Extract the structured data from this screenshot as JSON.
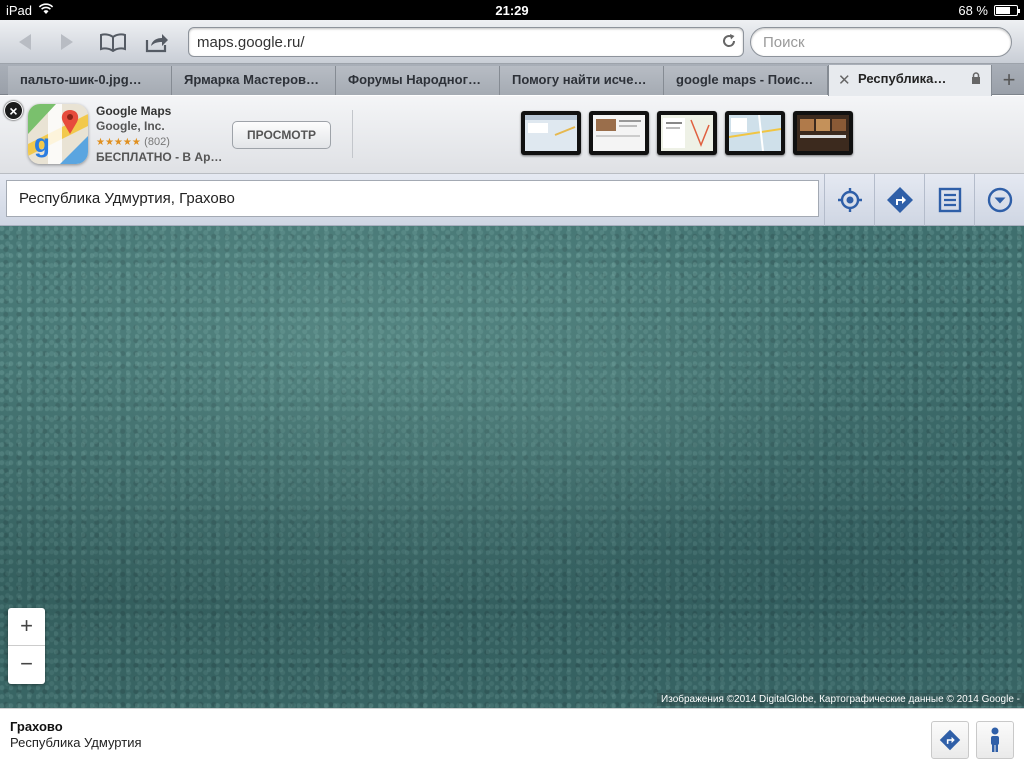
{
  "status": {
    "device": "iPad",
    "time": "21:29",
    "battery": "68 %",
    "battery_level": 0.68
  },
  "toolbar": {
    "url": "maps.google.ru/",
    "search_placeholder": "Поиск"
  },
  "tabs": [
    {
      "label": "пальто-шик-0.jpg…"
    },
    {
      "label": "Ярмарка Мастеров…"
    },
    {
      "label": "Форумы Народног…"
    },
    {
      "label": "Помогу найти исче…"
    },
    {
      "label": "google maps - Поис…"
    },
    {
      "label": "Республика…"
    }
  ],
  "banner": {
    "app_name": "Google Maps",
    "developer": "Google, Inc.",
    "stars": "★★★★★",
    "rating_count": "(802)",
    "price": "БЕСПЛАТНО - В Ap…",
    "view_button": "ПРОСМОТР"
  },
  "maps": {
    "search_value": "Республика Удмуртия, Грахово",
    "attribution": "Изображения ©2014 DigitalGlobe, Картографические данные © 2014 Google -",
    "zoom_in": "+",
    "zoom_out": "−"
  },
  "place": {
    "name": "Грахово",
    "region": "Республика Удмуртия"
  },
  "colors": {
    "map_base": "#3f6f6e",
    "maps_blue": "#2f5fa8"
  }
}
